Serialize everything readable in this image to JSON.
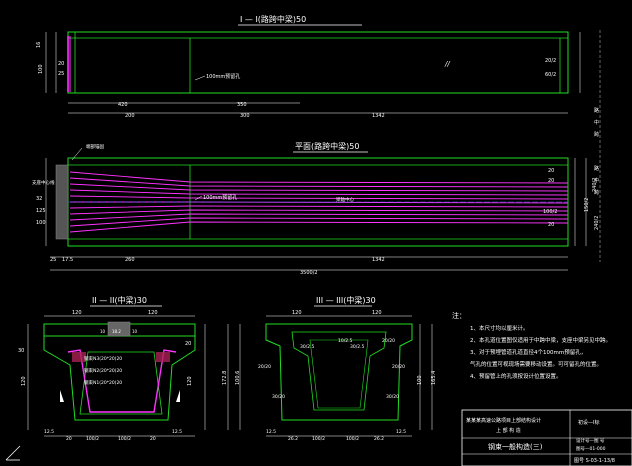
{
  "titles": {
    "section_1_1": "I — I(路跨中梁)50",
    "plan": "平面(路跨中梁)50",
    "section_2_2": "II — II(中梁)30",
    "section_3_3": "III — III(中梁)30"
  },
  "top_view": {
    "dims_bottom_row1": [
      "420",
      "350"
    ],
    "dims_bottom_row2": [
      "200",
      "300",
      "1342"
    ],
    "side_left": [
      "16",
      "100",
      "20",
      "25"
    ],
    "side_right": [
      "20/2",
      "60/2"
    ],
    "label_rebar": "100mm预留孔",
    "right_col": [
      "路",
      "中",
      "跨"
    ]
  },
  "plan_view": {
    "label_rebar": "100mm预留孔",
    "center_label": "梁轴中心",
    "left_label": "支座中心线",
    "end_label": "端部锚固",
    "dims_bottom": [
      "25",
      "17.5",
      "260",
      "1342"
    ],
    "dims_total": "3500/2",
    "side_left": [
      "32",
      "125",
      "100"
    ],
    "side_right": [
      "20",
      "20",
      "100/2",
      "20",
      "240/2",
      "150/2",
      "240/2"
    ],
    "right_col": [
      "路",
      "中",
      "跨"
    ]
  },
  "section2": {
    "top_dims": [
      "120",
      "120"
    ],
    "small_dims": [
      "10",
      "18.2",
      "10"
    ],
    "labels_rebar": [
      "钢束N3(20*20)20",
      "钢束N2(20*20)20",
      "钢束N1(20*20)20"
    ],
    "bottom_dims": [
      "12.5",
      "20",
      "100/2",
      "100/2",
      "20",
      "12.5"
    ],
    "side_left": [
      "30",
      "120"
    ],
    "side_right": [
      "20",
      "120"
    ]
  },
  "section3": {
    "top_dims": [
      "120",
      "120"
    ],
    "labels": [
      "30/2.5",
      "30/2.5",
      "10/2.5",
      "30/20",
      "30/20",
      "20/20",
      "20/20",
      "20/20"
    ],
    "bottom_dims": [
      "12.5",
      "26.2",
      "100/2",
      "100/2",
      "26.2",
      "12.5"
    ],
    "side_left": [
      "172.8",
      "100.6"
    ],
    "side_right": [
      "100",
      "165.4"
    ]
  },
  "notes": {
    "header": "注：",
    "items": [
      "1、本尺寸均以厘米计。",
      "2、本孔道位置图仅适用于中跨中梁，支座中梁另见中跨。",
      "3、对于预埋管道孔道直径4个100mm预留孔，",
      "气孔的位置可视现场需要移动设置。可可留孔的位置。",
      "4、预留管上的孔须按设计位置设置。"
    ]
  },
  "title_block": {
    "project_left": "某某某高速公路项目上部结构设计",
    "project_left2": "上 部 构 造",
    "drawing_title": "钢束一般构造(三)",
    "right_top": "初设—I标",
    "right_mid": "设计号—图 号",
    "right_mid2": "图号—01-000",
    "sheet": "图号 S-03-1-13/8"
  }
}
